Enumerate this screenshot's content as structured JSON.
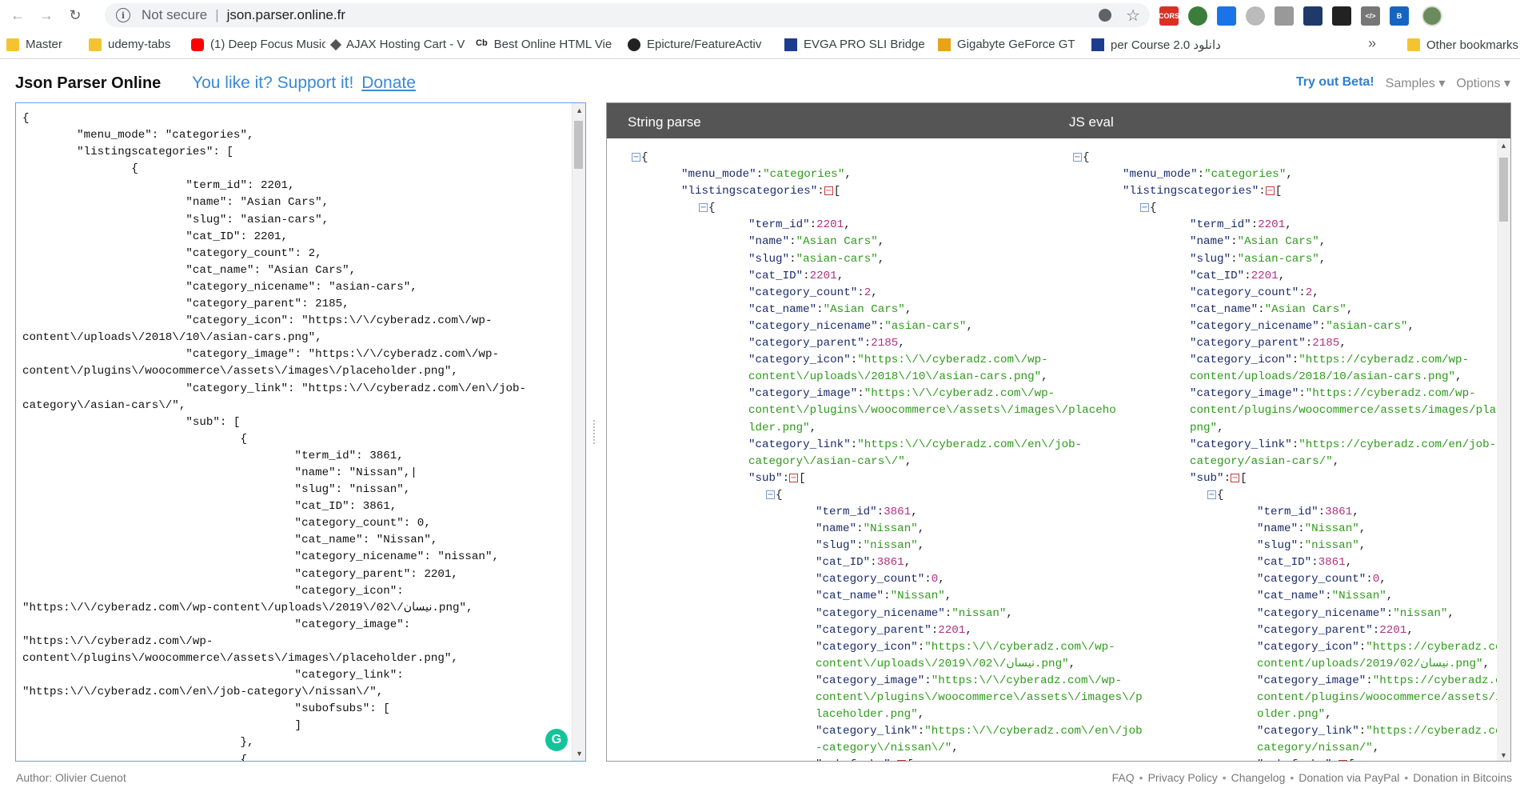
{
  "browser": {
    "secure_label": "Not secure",
    "url": "json.parser.online.fr",
    "bookmarks": [
      {
        "label": "Master",
        "icon": "folder-icon"
      },
      {
        "label": "udemy-tabs",
        "icon": "folder-icon"
      },
      {
        "label": "(1) Deep Focus Music",
        "icon": "youtube-icon"
      },
      {
        "label": "AJAX Hosting Cart - V",
        "icon": "ajax-icon"
      },
      {
        "label": "Best Online HTML Vie",
        "icon": "cb-icon"
      },
      {
        "label": "Epicture/FeatureActiv",
        "icon": "github-icon"
      },
      {
        "label": "EVGA PRO SLI Bridge",
        "icon": "evga-icon"
      },
      {
        "label": "Gigabyte GeForce GT",
        "icon": "gigabyte-icon"
      },
      {
        "label": "per Course 2.0 دانلود",
        "icon": "course-icon"
      }
    ],
    "more_label": "»",
    "other_bookmarks": "Other bookmarks"
  },
  "header": {
    "title": "Json Parser Online",
    "support_text": "You like it? Support it!",
    "donate_link": "Donate",
    "try_beta": "Try out Beta!",
    "samples": "Samples ▾",
    "options": "Options ▾"
  },
  "editor": {
    "content": "{\n        \"menu_mode\": \"categories\",\n        \"listingscategories\": [\n                {\n                        \"term_id\": 2201,\n                        \"name\": \"Asian Cars\",\n                        \"slug\": \"asian-cars\",\n                        \"cat_ID\": 2201,\n                        \"category_count\": 2,\n                        \"cat_name\": \"Asian Cars\",\n                        \"category_nicename\": \"asian-cars\",\n                        \"category_parent\": 2185,\n                        \"category_icon\": \"https:\\/\\/cyberadz.com\\/wp-\ncontent\\/uploads\\/2018\\/10\\/asian-cars.png\",\n                        \"category_image\": \"https:\\/\\/cyberadz.com\\/wp-\ncontent\\/plugins\\/woocommerce\\/assets\\/images\\/placeholder.png\",\n                        \"category_link\": \"https:\\/\\/cyberadz.com\\/en\\/job-\ncategory\\/asian-cars\\/\",\n                        \"sub\": [\n                                {\n                                        \"term_id\": 3861,\n                                        \"name\": \"Nissan\",|\n                                        \"slug\": \"nissan\",\n                                        \"cat_ID\": 3861,\n                                        \"category_count\": 0,\n                                        \"cat_name\": \"Nissan\",\n                                        \"category_nicename\": \"nissan\",\n                                        \"category_parent\": 2201,\n                                        \"category_icon\":\n\"https:\\/\\/cyberadz.com\\/wp-content\\/uploads\\/2019\\/02\\/نیسان.png\",\n                                        \"category_image\":\n\"https:\\/\\/cyberadz.com\\/wp-\ncontent\\/plugins\\/woocommerce\\/assets\\/images\\/placeholder.png\",\n                                        \"category_link\":\n\"https:\\/\\/cyberadz.com\\/en\\/job-category\\/nissan\\/\",\n                                        \"subofsubs\": [\n                                        ]\n                                },\n                                {"
  },
  "output": {
    "string_parse_title": "String parse",
    "js_eval_title": "JS eval",
    "string_parse_lines": [
      {
        "i": 0,
        "t": "brace",
        "v": "{"
      },
      {
        "i": 1,
        "t": "kv",
        "k": "\"menu_mode\"",
        "v": "\"categories\"",
        "c": "s"
      },
      {
        "i": 1,
        "t": "arr",
        "k": "\"listingscategories\""
      },
      {
        "i": 2,
        "t": "brace",
        "v": "{"
      },
      {
        "i": 3,
        "t": "kv",
        "k": "\"term_id\"",
        "v": "2201",
        "c": "n"
      },
      {
        "i": 3,
        "t": "kv",
        "k": "\"name\"",
        "v": "\"Asian Cars\"",
        "c": "s"
      },
      {
        "i": 3,
        "t": "kv",
        "k": "\"slug\"",
        "v": "\"asian-cars\"",
        "c": "s"
      },
      {
        "i": 3,
        "t": "kv",
        "k": "\"cat_ID\"",
        "v": "2201",
        "c": "n"
      },
      {
        "i": 3,
        "t": "kv",
        "k": "\"category_count\"",
        "v": "2",
        "c": "n"
      },
      {
        "i": 3,
        "t": "kv",
        "k": "\"cat_name\"",
        "v": "\"Asian Cars\"",
        "c": "s"
      },
      {
        "i": 3,
        "t": "kv",
        "k": "\"category_nicename\"",
        "v": "\"asian-cars\"",
        "c": "s"
      },
      {
        "i": 3,
        "t": "kv",
        "k": "\"category_parent\"",
        "v": "2185",
        "c": "n"
      },
      {
        "i": 3,
        "t": "kv",
        "k": "\"category_icon\"",
        "v": "\"https:\\/\\/cyberadz.com\\/wp-",
        "c": "s",
        "nc": true
      },
      {
        "i": 3,
        "t": "cont",
        "v": "content\\/uploads\\/2018\\/10\\/asian-cars.png\"",
        "c": "s"
      },
      {
        "i": 3,
        "t": "kv",
        "k": "\"category_image\"",
        "v": "\"https:\\/\\/cyberadz.com\\/wp-",
        "c": "s",
        "nc": true
      },
      {
        "i": 3,
        "t": "cont",
        "v": "content\\/plugins\\/woocommerce\\/assets\\/images\\/placeho",
        "c": "s",
        "nc": true
      },
      {
        "i": 3,
        "t": "cont",
        "v": "lder.png\"",
        "c": "s"
      },
      {
        "i": 3,
        "t": "kv",
        "k": "\"category_link\"",
        "v": "\"https:\\/\\/cyberadz.com\\/en\\/job-",
        "c": "s",
        "nc": true
      },
      {
        "i": 3,
        "t": "cont",
        "v": "category\\/asian-cars\\/\"",
        "c": "s"
      },
      {
        "i": 3,
        "t": "arr",
        "k": "\"sub\""
      },
      {
        "i": 4,
        "t": "brace",
        "v": "{"
      },
      {
        "i": 5,
        "t": "kv",
        "k": "\"term_id\"",
        "v": "3861",
        "c": "n"
      },
      {
        "i": 5,
        "t": "kv",
        "k": "\"name\"",
        "v": "\"Nissan\"",
        "c": "s"
      },
      {
        "i": 5,
        "t": "kv",
        "k": "\"slug\"",
        "v": "\"nissan\"",
        "c": "s"
      },
      {
        "i": 5,
        "t": "kv",
        "k": "\"cat_ID\"",
        "v": "3861",
        "c": "n"
      },
      {
        "i": 5,
        "t": "kv",
        "k": "\"category_count\"",
        "v": "0",
        "c": "n"
      },
      {
        "i": 5,
        "t": "kv",
        "k": "\"cat_name\"",
        "v": "\"Nissan\"",
        "c": "s"
      },
      {
        "i": 5,
        "t": "kv",
        "k": "\"category_nicename\"",
        "v": "\"nissan\"",
        "c": "s"
      },
      {
        "i": 5,
        "t": "kv",
        "k": "\"category_parent\"",
        "v": "2201",
        "c": "n"
      },
      {
        "i": 5,
        "t": "kv",
        "k": "\"category_icon\"",
        "v": "\"https:\\/\\/cyberadz.com\\/wp-",
        "c": "s",
        "nc": true
      },
      {
        "i": 5,
        "t": "cont",
        "v": "content\\/uploads\\/2019\\/02\\/نیسان.png\"",
        "c": "s"
      },
      {
        "i": 5,
        "t": "kv",
        "k": "\"category_image\"",
        "v": "\"https:\\/\\/cyberadz.com\\/wp-",
        "c": "s",
        "nc": true
      },
      {
        "i": 5,
        "t": "cont",
        "v": "content\\/plugins\\/woocommerce\\/assets\\/images\\/p",
        "c": "s",
        "nc": true
      },
      {
        "i": 5,
        "t": "cont",
        "v": "laceholder.png\"",
        "c": "s"
      },
      {
        "i": 5,
        "t": "kv",
        "k": "\"category_link\"",
        "v": "\"https:\\/\\/cyberadz.com\\/en\\/job",
        "c": "s",
        "nc": true
      },
      {
        "i": 5,
        "t": "cont",
        "v": "-category\\/nissan\\/\"",
        "c": "s"
      },
      {
        "i": 5,
        "t": "arr",
        "k": "\"subofsubs\""
      }
    ],
    "js_eval_lines": [
      {
        "i": 0,
        "t": "brace",
        "v": "{"
      },
      {
        "i": 1,
        "t": "kv",
        "k": "\"menu_mode\"",
        "v": "\"categories\"",
        "c": "s"
      },
      {
        "i": 1,
        "t": "arr",
        "k": "\"listingscategories\""
      },
      {
        "i": 2,
        "t": "brace",
        "v": "{"
      },
      {
        "i": 3,
        "t": "kv",
        "k": "\"term_id\"",
        "v": "2201",
        "c": "n"
      },
      {
        "i": 3,
        "t": "kv",
        "k": "\"name\"",
        "v": "\"Asian Cars\"",
        "c": "s"
      },
      {
        "i": 3,
        "t": "kv",
        "k": "\"slug\"",
        "v": "\"asian-cars\"",
        "c": "s"
      },
      {
        "i": 3,
        "t": "kv",
        "k": "\"cat_ID\"",
        "v": "2201",
        "c": "n"
      },
      {
        "i": 3,
        "t": "kv",
        "k": "\"category_count\"",
        "v": "2",
        "c": "n"
      },
      {
        "i": 3,
        "t": "kv",
        "k": "\"cat_name\"",
        "v": "\"Asian Cars\"",
        "c": "s"
      },
      {
        "i": 3,
        "t": "kv",
        "k": "\"category_nicename\"",
        "v": "\"asian-cars\"",
        "c": "s"
      },
      {
        "i": 3,
        "t": "kv",
        "k": "\"category_parent\"",
        "v": "2185",
        "c": "n"
      },
      {
        "i": 3,
        "t": "kv",
        "k": "\"category_icon\"",
        "v": "\"https://cyberadz.com/wp-",
        "c": "s",
        "nc": true
      },
      {
        "i": 3,
        "t": "cont",
        "v": "content/uploads/2018/10/asian-cars.png\"",
        "c": "s"
      },
      {
        "i": 3,
        "t": "kv",
        "k": "\"category_image\"",
        "v": "\"https://cyberadz.com/wp-",
        "c": "s",
        "nc": true
      },
      {
        "i": 3,
        "t": "cont",
        "v": "content/plugins/woocommerce/assets/images/placeholder.",
        "c": "s",
        "nc": true
      },
      {
        "i": 3,
        "t": "cont",
        "v": "png\"",
        "c": "s"
      },
      {
        "i": 3,
        "t": "kv",
        "k": "\"category_link\"",
        "v": "\"https://cyberadz.com/en/job-",
        "c": "s",
        "nc": true
      },
      {
        "i": 3,
        "t": "cont",
        "v": "category/asian-cars/\"",
        "c": "s"
      },
      {
        "i": 3,
        "t": "arr",
        "k": "\"sub\""
      },
      {
        "i": 4,
        "t": "brace",
        "v": "{"
      },
      {
        "i": 5,
        "t": "kv",
        "k": "\"term_id\"",
        "v": "3861",
        "c": "n"
      },
      {
        "i": 5,
        "t": "kv",
        "k": "\"name\"",
        "v": "\"Nissan\"",
        "c": "s"
      },
      {
        "i": 5,
        "t": "kv",
        "k": "\"slug\"",
        "v": "\"nissan\"",
        "c": "s"
      },
      {
        "i": 5,
        "t": "kv",
        "k": "\"cat_ID\"",
        "v": "3861",
        "c": "n"
      },
      {
        "i": 5,
        "t": "kv",
        "k": "\"category_count\"",
        "v": "0",
        "c": "n"
      },
      {
        "i": 5,
        "t": "kv",
        "k": "\"cat_name\"",
        "v": "\"Nissan\"",
        "c": "s"
      },
      {
        "i": 5,
        "t": "kv",
        "k": "\"category_nicename\"",
        "v": "\"nissan\"",
        "c": "s"
      },
      {
        "i": 5,
        "t": "kv",
        "k": "\"category_parent\"",
        "v": "2201",
        "c": "n"
      },
      {
        "i": 5,
        "t": "kv",
        "k": "\"category_icon\"",
        "v": "\"https://cyberadz.com/wp-",
        "c": "s",
        "nc": true
      },
      {
        "i": 5,
        "t": "cont",
        "v": "content/uploads/2019/02/نیسان.png\"",
        "c": "s"
      },
      {
        "i": 5,
        "t": "kv",
        "k": "\"category_image\"",
        "v": "\"https://cyberadz.com/wp-",
        "c": "s",
        "nc": true
      },
      {
        "i": 5,
        "t": "cont",
        "v": "content/plugins/woocommerce/assets/images/placeh",
        "c": "s",
        "nc": true
      },
      {
        "i": 5,
        "t": "cont",
        "v": "older.png\"",
        "c": "s"
      },
      {
        "i": 5,
        "t": "kv",
        "k": "\"category_link\"",
        "v": "\"https://cyberadz.com/en/job-",
        "c": "s",
        "nc": true
      },
      {
        "i": 5,
        "t": "cont",
        "v": "category/nissan/\"",
        "c": "s"
      },
      {
        "i": 5,
        "t": "arr",
        "k": "\"subofsubs\""
      }
    ]
  },
  "footer": {
    "author": "Author: Olivier Cuenot",
    "links": [
      "FAQ",
      "Privacy Policy",
      "Changelog",
      "Donation via PayPal",
      "Donation in Bitcoins"
    ]
  }
}
